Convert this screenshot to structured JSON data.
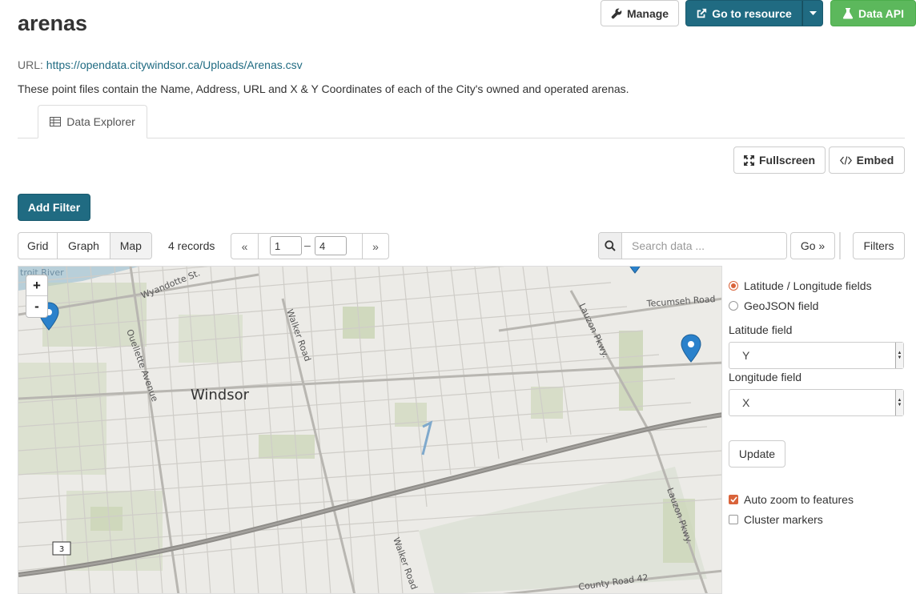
{
  "page": {
    "title": "arenas",
    "url_label": "URL:",
    "url": "https://opendata.citywindsor.ca/Uploads/Arenas.csv",
    "description": "These point files contain the Name, Address, URL and X & Y Coordinates of each of the City's owned and operated arenas."
  },
  "actions": {
    "manage": "Manage",
    "go_to_resource": "Go to resource",
    "data_api": "Data API"
  },
  "tabs": [
    {
      "label": "Data Explorer"
    }
  ],
  "view_tools": {
    "fullscreen": "Fullscreen",
    "embed": "Embed"
  },
  "filters": {
    "add_filter": "Add Filter",
    "filters_button": "Filters"
  },
  "views": [
    "Grid",
    "Graph",
    "Map"
  ],
  "records": "4 records",
  "pager": {
    "prev": "«",
    "next": "»",
    "from": "1",
    "to": "4",
    "dash": "–"
  },
  "search": {
    "placeholder": "Search data ...",
    "go": "Go »"
  },
  "map": {
    "zoom_in": "+",
    "zoom_out": "-",
    "labels": [
      "Windsor",
      "Wyandotte St.",
      "Ouellette Avenue",
      "Walker Road",
      "Lauzon Pkwy.",
      "Tecumseh Road",
      "County Road 42",
      "troit River"
    ],
    "route_shield": "3",
    "markers": 3
  },
  "map_settings": {
    "latlon_option": "Latitude / Longitude fields",
    "geojson_option": "GeoJSON field",
    "lat_label": "Latitude field",
    "lat_value": "Y",
    "lon_label": "Longitude field",
    "lon_value": "X",
    "update": "Update",
    "auto_zoom": "Auto zoom to features",
    "cluster": "Cluster markers",
    "auto_zoom_checked": true,
    "cluster_checked": false
  },
  "colors": {
    "primary": "#206b82",
    "success": "#5cb85c",
    "accent": "#d9633a",
    "marker": "#2a81cb"
  }
}
